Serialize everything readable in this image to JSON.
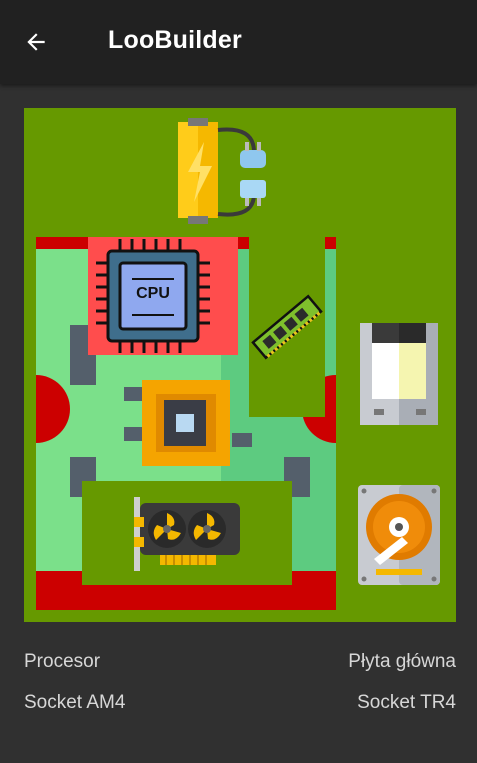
{
  "appbar": {
    "title": "LooBuilder"
  },
  "colors": {
    "background": "#303030",
    "appbar": "#212121",
    "canvas": "#669900",
    "motherboard": "#cc0000",
    "board_inner": "#7be08a"
  },
  "components": {
    "power_supply": "power-supply-icon",
    "motherboard": "motherboard-icon",
    "cpu": "cpu-icon",
    "ram": "ram-icon",
    "gpu": "gpu-icon",
    "drive": "drive-icon",
    "hdd": "hdd-icon",
    "cpu_label": "CPU"
  },
  "specs": {
    "left_label": "Procesor",
    "right_label": "Płyta główna",
    "left_value": "Socket AM4",
    "right_value": "Socket TR4"
  }
}
